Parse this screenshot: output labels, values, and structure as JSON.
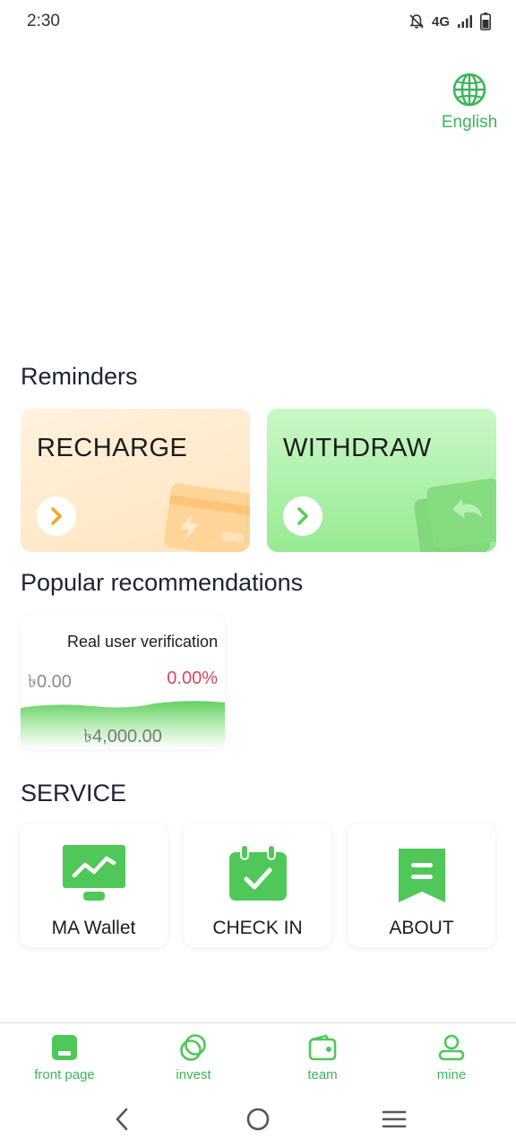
{
  "status_bar": {
    "time": "2:30",
    "network": "4G"
  },
  "header": {
    "language_label": "English",
    "language_icon": "globe-icon"
  },
  "reminders": {
    "title": "Reminders",
    "recharge": {
      "label": "RECHARGE",
      "icon": "chevron-right-icon"
    },
    "withdraw": {
      "label": "WITHDRAW",
      "icon": "chevron-right-icon"
    }
  },
  "popular": {
    "title": "Popular recommendations",
    "items": [
      {
        "name": "Real user verification",
        "price": "৳0.00",
        "rate": "0.00%",
        "amount": "৳4,000.00"
      }
    ]
  },
  "service": {
    "title": "SERVICE",
    "items": [
      {
        "label": "MA Wallet",
        "icon": "monitor-chart-icon"
      },
      {
        "label": "CHECK IN",
        "icon": "calendar-check-icon"
      },
      {
        "label": "ABOUT",
        "icon": "bookmark-doc-icon"
      }
    ]
  },
  "tabbar": {
    "items": [
      {
        "label": "front page",
        "icon": "home-icon"
      },
      {
        "label": "invest",
        "icon": "coins-icon"
      },
      {
        "label": "team",
        "icon": "wallet-icon"
      },
      {
        "label": "mine",
        "icon": "user-icon"
      }
    ]
  },
  "colors": {
    "accent": "#3cb55a",
    "rate": "#d9475f",
    "recharge_bg": "#ffe4bd",
    "withdraw_bg": "#98ea93"
  }
}
